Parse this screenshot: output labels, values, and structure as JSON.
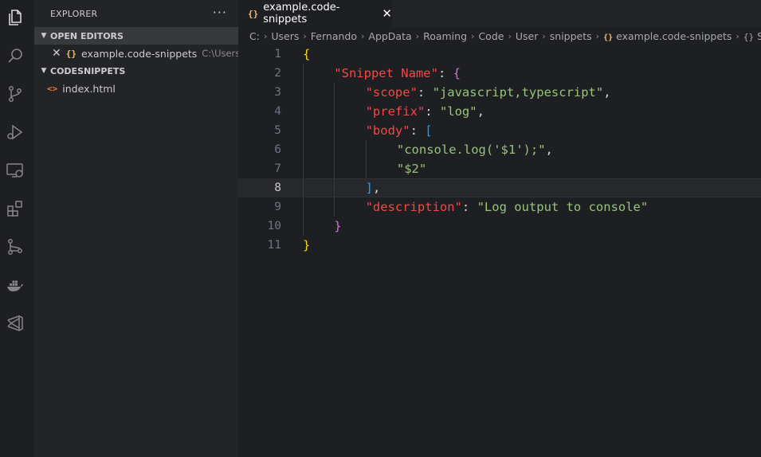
{
  "activity_bar": {
    "items": [
      {
        "name": "explorer",
        "icon": "files-icon"
      },
      {
        "name": "search",
        "icon": "search-icon"
      },
      {
        "name": "source-control",
        "icon": "source-control-icon"
      },
      {
        "name": "run-debug",
        "icon": "run-debug-icon"
      },
      {
        "name": "remote-explorer",
        "icon": "remote-explorer-icon"
      },
      {
        "name": "extensions",
        "icon": "extensions-icon"
      },
      {
        "name": "git-graph",
        "icon": "git-graph-icon"
      },
      {
        "name": "docker",
        "icon": "docker-icon"
      },
      {
        "name": "visual-studio",
        "icon": "visual-studio-icon"
      }
    ]
  },
  "sidebar": {
    "title": "EXPLORER",
    "more_label": "···",
    "open_editors": {
      "title": "OPEN EDITORS",
      "items": [
        {
          "close": "✕",
          "glyph": "{}",
          "label": "example.code-snippets",
          "path": "C:\\Users..."
        }
      ]
    },
    "folder": {
      "title": "CODESNIPPETS",
      "items": [
        {
          "glyph": "<>",
          "label": "index.html"
        }
      ]
    }
  },
  "editor": {
    "tab": {
      "glyph": "{}",
      "label": "example.code-snippets",
      "close": "✕"
    },
    "breadcrumb": {
      "parts": [
        "C:",
        "Users",
        "Fernando",
        "AppData",
        "Roaming",
        "Code",
        "User",
        "snippets"
      ],
      "file_glyph": "{}",
      "file": "example.code-snippets",
      "symbol_glyph": "{}",
      "symbol": "Snippet Name",
      "separator": "›"
    },
    "current_line": 8,
    "lines": [
      {
        "n": "1",
        "indent": 0,
        "tokens": [
          {
            "t": "{",
            "c": "tk-b1"
          }
        ]
      },
      {
        "n": "2",
        "indent": 1,
        "tokens": [
          {
            "t": "\"Snippet Name\"",
            "c": "tk-key"
          },
          {
            "t": ": ",
            "c": "tk-punc"
          },
          {
            "t": "{",
            "c": "tk-b2"
          }
        ]
      },
      {
        "n": "3",
        "indent": 2,
        "tokens": [
          {
            "t": "\"scope\"",
            "c": "tk-key"
          },
          {
            "t": ": ",
            "c": "tk-punc"
          },
          {
            "t": "\"javascript,typescript\"",
            "c": "tk-str"
          },
          {
            "t": ",",
            "c": "tk-punc"
          }
        ]
      },
      {
        "n": "4",
        "indent": 2,
        "tokens": [
          {
            "t": "\"prefix\"",
            "c": "tk-key"
          },
          {
            "t": ": ",
            "c": "tk-punc"
          },
          {
            "t": "\"log\"",
            "c": "tk-str"
          },
          {
            "t": ",",
            "c": "tk-punc"
          }
        ]
      },
      {
        "n": "5",
        "indent": 2,
        "tokens": [
          {
            "t": "\"body\"",
            "c": "tk-key"
          },
          {
            "t": ": ",
            "c": "tk-punc"
          },
          {
            "t": "[",
            "c": "tk-b3"
          }
        ]
      },
      {
        "n": "6",
        "indent": 3,
        "tokens": [
          {
            "t": "\"console.log('$1');\"",
            "c": "tk-str"
          },
          {
            "t": ",",
            "c": "tk-punc"
          }
        ]
      },
      {
        "n": "7",
        "indent": 3,
        "tokens": [
          {
            "t": "\"$2\"",
            "c": "tk-str"
          }
        ]
      },
      {
        "n": "8",
        "indent": 2,
        "tokens": [
          {
            "t": "]",
            "c": "tk-b3"
          },
          {
            "t": ",",
            "c": "tk-punc"
          }
        ]
      },
      {
        "n": "9",
        "indent": 2,
        "tokens": [
          {
            "t": "\"description\"",
            "c": "tk-key"
          },
          {
            "t": ": ",
            "c": "tk-punc"
          },
          {
            "t": "\"Log output to console\"",
            "c": "tk-str"
          }
        ]
      },
      {
        "n": "10",
        "indent": 1,
        "tokens": [
          {
            "t": "}",
            "c": "tk-b2"
          }
        ]
      },
      {
        "n": "11",
        "indent": 0,
        "tokens": [
          {
            "t": "}",
            "c": "tk-b1"
          }
        ]
      }
    ]
  },
  "colors": {
    "background": "#1e1f22",
    "sidebar": "#232428",
    "key": "#f44747",
    "string": "#98c379",
    "bracket_1": "#ffd700",
    "bracket_2": "#da70d6",
    "bracket_3": "#179fff"
  }
}
